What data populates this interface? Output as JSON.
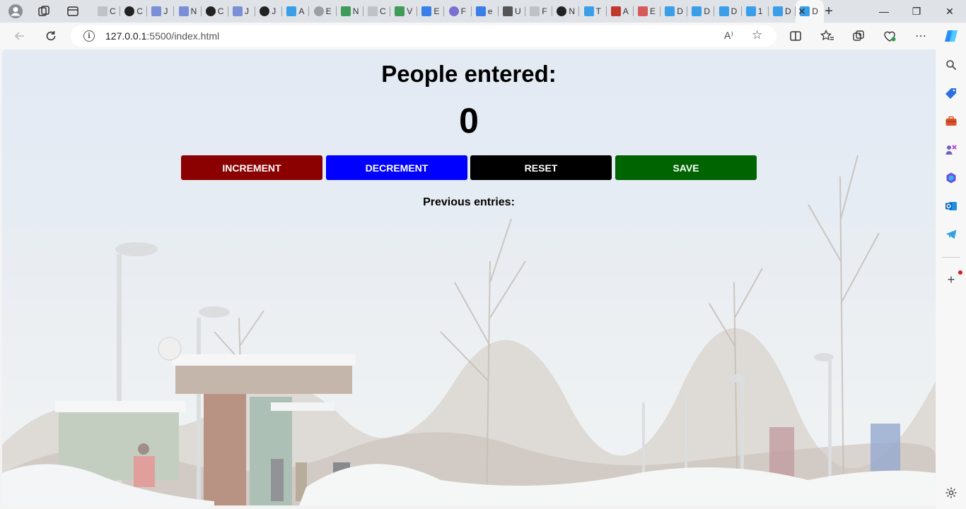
{
  "browser": {
    "url_host": "127.0.0.1",
    "url_path": ":5500/index.html",
    "read_aloud_label": "A⁾",
    "tabs": [
      {
        "label": "C",
        "icon": "file-icon"
      },
      {
        "label": "C",
        "icon": "github-icon"
      },
      {
        "label": "J",
        "icon": "docs-icon"
      },
      {
        "label": "N",
        "icon": "docs-icon"
      },
      {
        "label": "C",
        "icon": "github-icon"
      },
      {
        "label": "J",
        "icon": "docs-icon"
      },
      {
        "label": "J",
        "icon": "github-icon"
      },
      {
        "label": "A",
        "icon": "flutter-icon"
      },
      {
        "label": "E",
        "icon": "settings-icon"
      },
      {
        "label": "N",
        "icon": "sheet-icon"
      },
      {
        "label": "C",
        "icon": "file-icon"
      },
      {
        "label": "V",
        "icon": "sheet-icon"
      },
      {
        "label": "E",
        "icon": "search-icon"
      },
      {
        "label": "F",
        "icon": "circle-icon"
      },
      {
        "label": "e",
        "icon": "search-icon"
      },
      {
        "label": "U",
        "icon": "medium-icon"
      },
      {
        "label": "F",
        "icon": "file-icon"
      },
      {
        "label": "N",
        "icon": "github-icon"
      },
      {
        "label": "T",
        "icon": "flutter-icon"
      },
      {
        "label": "A",
        "icon": "red-icon"
      },
      {
        "label": "E",
        "icon": "js-icon"
      },
      {
        "label": "D",
        "icon": "flutter-icon"
      },
      {
        "label": "D",
        "icon": "flutter-icon"
      },
      {
        "label": "D",
        "icon": "flutter-icon"
      },
      {
        "label": "1",
        "icon": "flutter-icon"
      },
      {
        "label": "D",
        "icon": "flutter-icon"
      },
      {
        "label": "D",
        "icon": "flutter-icon",
        "active": true
      }
    ]
  },
  "page": {
    "title": "People entered:",
    "count": "0",
    "buttons": {
      "increment": "INCREMENT",
      "decrement": "DECREMENT",
      "reset": "RESET",
      "save": "SAVE"
    },
    "previous_label": "Previous entries:"
  },
  "colors": {
    "increment": "#8b0000",
    "decrement": "#0000ff",
    "reset": "#000000",
    "save": "#006400"
  }
}
